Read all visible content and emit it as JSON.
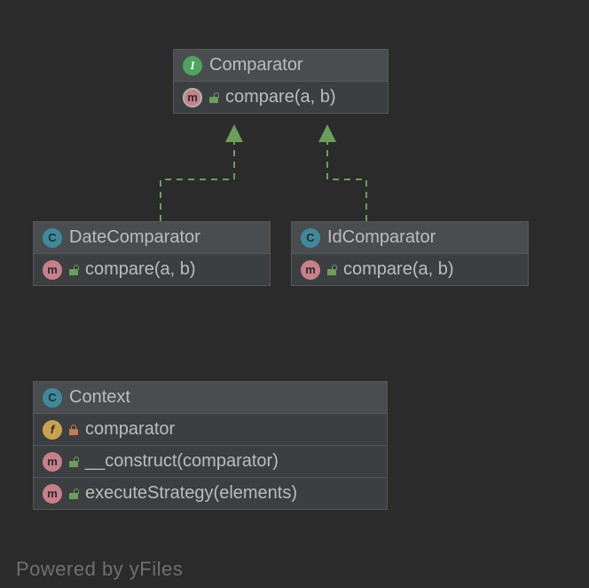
{
  "watermark": "Powered by yFiles",
  "boxes": {
    "comparator": {
      "header": {
        "badge": "I",
        "label": "Comparator"
      },
      "members": [
        {
          "badge": "m-ring",
          "lock": "green-open",
          "label": "compare(a, b)"
        }
      ]
    },
    "dateComparator": {
      "header": {
        "badge": "C",
        "label": "DateComparator"
      },
      "members": [
        {
          "badge": "m",
          "lock": "green-open",
          "label": "compare(a, b)"
        }
      ]
    },
    "idComparator": {
      "header": {
        "badge": "C",
        "label": "IdComparator"
      },
      "members": [
        {
          "badge": "m",
          "lock": "green-open",
          "label": "compare(a, b)"
        }
      ]
    },
    "context": {
      "header": {
        "badge": "C",
        "label": "Context"
      },
      "members": [
        {
          "badge": "f",
          "lock": "red-closed",
          "label": "comparator"
        },
        {
          "badge": "m",
          "lock": "green-open",
          "label": "__construct(comparator)"
        },
        {
          "badge": "m",
          "lock": "green-open",
          "label": "executeStrategy(elements)"
        }
      ]
    }
  }
}
